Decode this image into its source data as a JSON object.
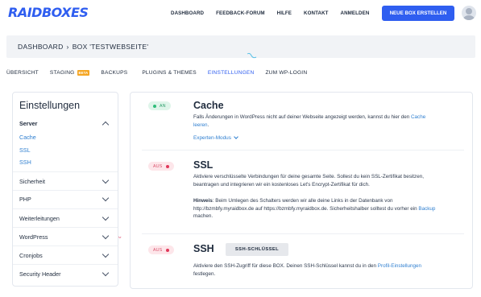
{
  "brand": {
    "logo_text": "RAIDBOXES",
    "accent": "#2f5ef0"
  },
  "nav": {
    "items": [
      "DASHBOARD",
      "FEEDBACK-FORUM",
      "HILFE",
      "KONTAKT",
      "ANMELDEN"
    ],
    "cta_label": "NEUE BOX ERSTELLEN"
  },
  "breadcrumb": {
    "root": "DASHBOARD",
    "separator": "›",
    "current": "BOX 'TESTWEBSEITE'"
  },
  "tabs": [
    {
      "label": "ÜBERSICHT"
    },
    {
      "label": "STAGING",
      "badge": "BETA"
    },
    {
      "label": "BACKUPS"
    },
    {
      "label": "PLUGINS & THEMES"
    },
    {
      "label": "EINSTELLUNGEN",
      "active": true
    },
    {
      "label": "ZUM WP-LOGIN"
    }
  ],
  "sidebar": {
    "title": "Einstellungen",
    "server": {
      "label": "Server",
      "subitems": [
        "Cache",
        "SSL",
        "SSH"
      ]
    },
    "items": [
      "Sicherheit",
      "PHP",
      "Weiterleitungen",
      "WordPress",
      "Cronjobs",
      "Security Header"
    ]
  },
  "sections": {
    "cache": {
      "status": "AN",
      "title": "Cache",
      "desc_prefix": "Falls Änderungen in WordPress nicht auf deiner Webseite angezeigt werden, kannst du hier den ",
      "desc_link": "Cache leeren",
      "desc_suffix": ".",
      "expert_label": "Experten-Modus"
    },
    "ssl": {
      "status": "AUS",
      "title": "SSL",
      "desc": "Aktiviere verschlüsselte Verbindungen für deine gesamte Seite. Sollest du kein SSL-Zertifikat besitzen, beantragen und integrieren wir ein kostenloses Let's Encrypt-Zertifikat für dich.",
      "hint_label": "Hinweis",
      "hint_text": ": Beim Umlegen des Schalters werden wir alle deine Links in der Datenbank von http://bzmbfy.myraidbox.de auf https://bzmbfy.myraidbox.de. Sicherheitshalber solltest du vorher ein ",
      "hint_link": "Backup",
      "hint_suffix": " machen."
    },
    "ssh": {
      "status": "AUS",
      "title": "SSH",
      "button_label": "SSH-SCHLÜSSEL",
      "desc_prefix": "Aktiviere den SSH-Zugriff für diese BOX. Deinen SSH-Schlüssel kannst du in den ",
      "desc_link": "Profil-Einstellungen",
      "desc_suffix": " festlegen."
    }
  }
}
